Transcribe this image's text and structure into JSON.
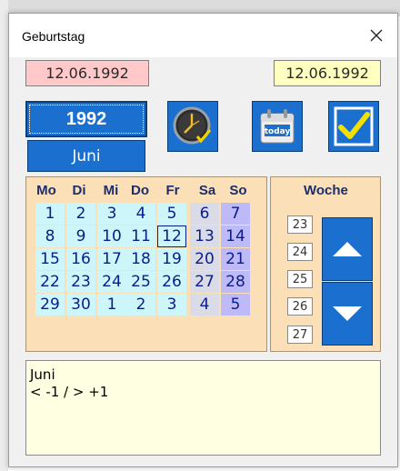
{
  "window": {
    "title": "Geburtstag"
  },
  "dates": {
    "left": "12.06.1992",
    "right": "12.06.1992"
  },
  "year": "1992",
  "month": "Juni",
  "buttons": {
    "today_label": "today"
  },
  "calendar": {
    "headers": [
      "Mo",
      "Di",
      "Mi",
      "Do",
      "Fr",
      "Sa",
      "So"
    ],
    "rows": [
      [
        "1",
        "2",
        "3",
        "4",
        "5",
        "6",
        "7"
      ],
      [
        "8",
        "9",
        "10",
        "11",
        "12",
        "13",
        "14"
      ],
      [
        "15",
        "16",
        "17",
        "18",
        "19",
        "20",
        "21"
      ],
      [
        "22",
        "23",
        "24",
        "25",
        "26",
        "27",
        "28"
      ],
      [
        "29",
        "30",
        "1",
        "2",
        "3",
        "4",
        "5"
      ]
    ],
    "selected_day": "12"
  },
  "week": {
    "title": "Woche",
    "numbers": [
      "23",
      "24",
      "25",
      "26",
      "27"
    ]
  },
  "info": {
    "line1": "Juni",
    "line2": "< -1 / > +1"
  },
  "colors": {
    "button_blue": "#1a6fcf",
    "panel_orange": "#fbdfb6",
    "weekday_cell": "#cdf6fa",
    "saturday_cell": "#d9dbe6",
    "sunday_cell": "#bdbaf7",
    "day_text": "#0b1c8c"
  }
}
